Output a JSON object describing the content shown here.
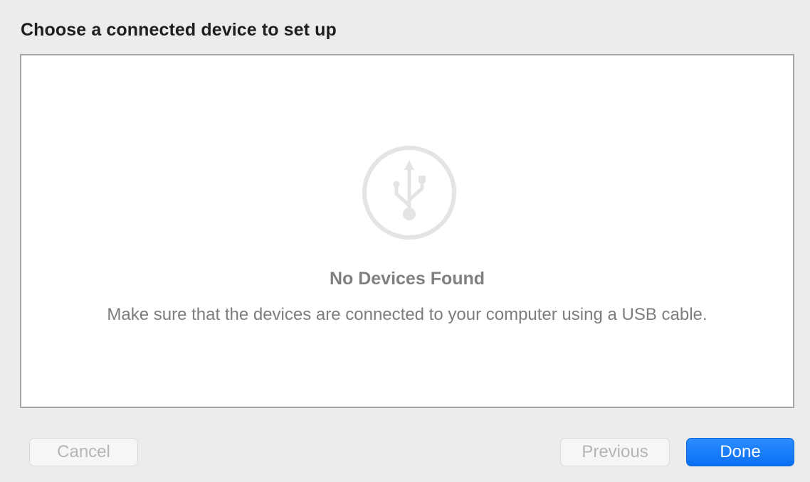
{
  "dialog": {
    "title": "Choose a connected device to set up"
  },
  "empty_state": {
    "icon": "usb-icon",
    "title": "No Devices Found",
    "message": "Make sure that the devices are connected to your computer using a USB cable."
  },
  "buttons": {
    "cancel": "Cancel",
    "previous": "Previous",
    "done": "Done"
  },
  "colors": {
    "accent": "#0a6ff2",
    "disabled_text": "#b5b5b5",
    "secondary_text": "#7c7c7c",
    "icon": "#e4e4e4"
  }
}
